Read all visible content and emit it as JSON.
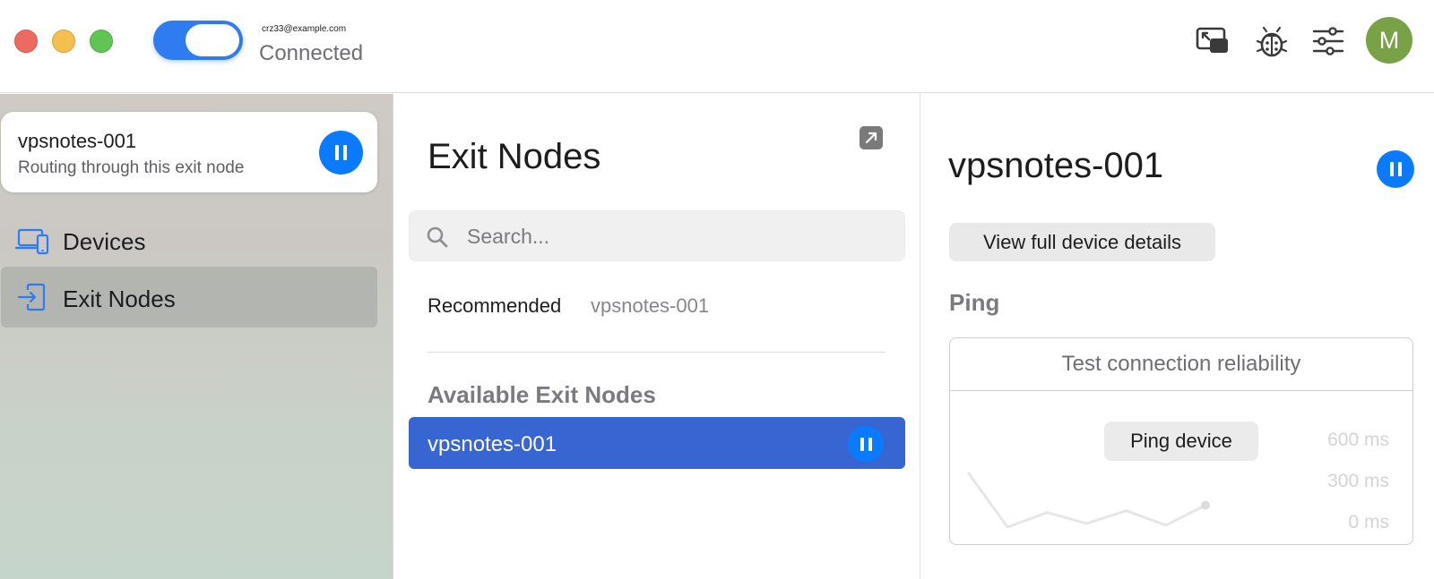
{
  "titlebar": {
    "vpn_toggle_on": true,
    "account_email": "crz33@example.com",
    "status": "Connected",
    "avatar_initial": "M",
    "icons": [
      "mini-player-icon",
      "bug-icon",
      "sliders-icon"
    ]
  },
  "sidebar": {
    "exit_card": {
      "name": "vpsnotes-001",
      "subtitle": "Routing through this exit node"
    },
    "items": [
      {
        "label": "Devices",
        "icon": "devices-icon"
      },
      {
        "label": "Exit Nodes",
        "icon": "exit-node-icon",
        "selected": true
      }
    ]
  },
  "middle": {
    "title": "Exit Nodes",
    "search_placeholder": "Search...",
    "recommended_label": "Recommended",
    "recommended_value": "vpsnotes-001",
    "available_title": "Available Exit Nodes",
    "nodes": [
      {
        "name": "vpsnotes-001",
        "selected": true
      }
    ]
  },
  "right": {
    "title": "vpsnotes-001",
    "details_button": "View full device details",
    "ping_title": "Ping",
    "ping_card_title": "Test connection reliability",
    "ping_button": "Ping device",
    "ping_ticks": [
      "600 ms",
      "300 ms",
      "0 ms"
    ],
    "ping_samples_ms": [
      150,
      0,
      40,
      10,
      45,
      5,
      60
    ]
  },
  "colors": {
    "accent": "#0a7aff",
    "selected_row": "#3765d1",
    "toggle": "#2f7cf0",
    "avatar": "#79a145"
  }
}
